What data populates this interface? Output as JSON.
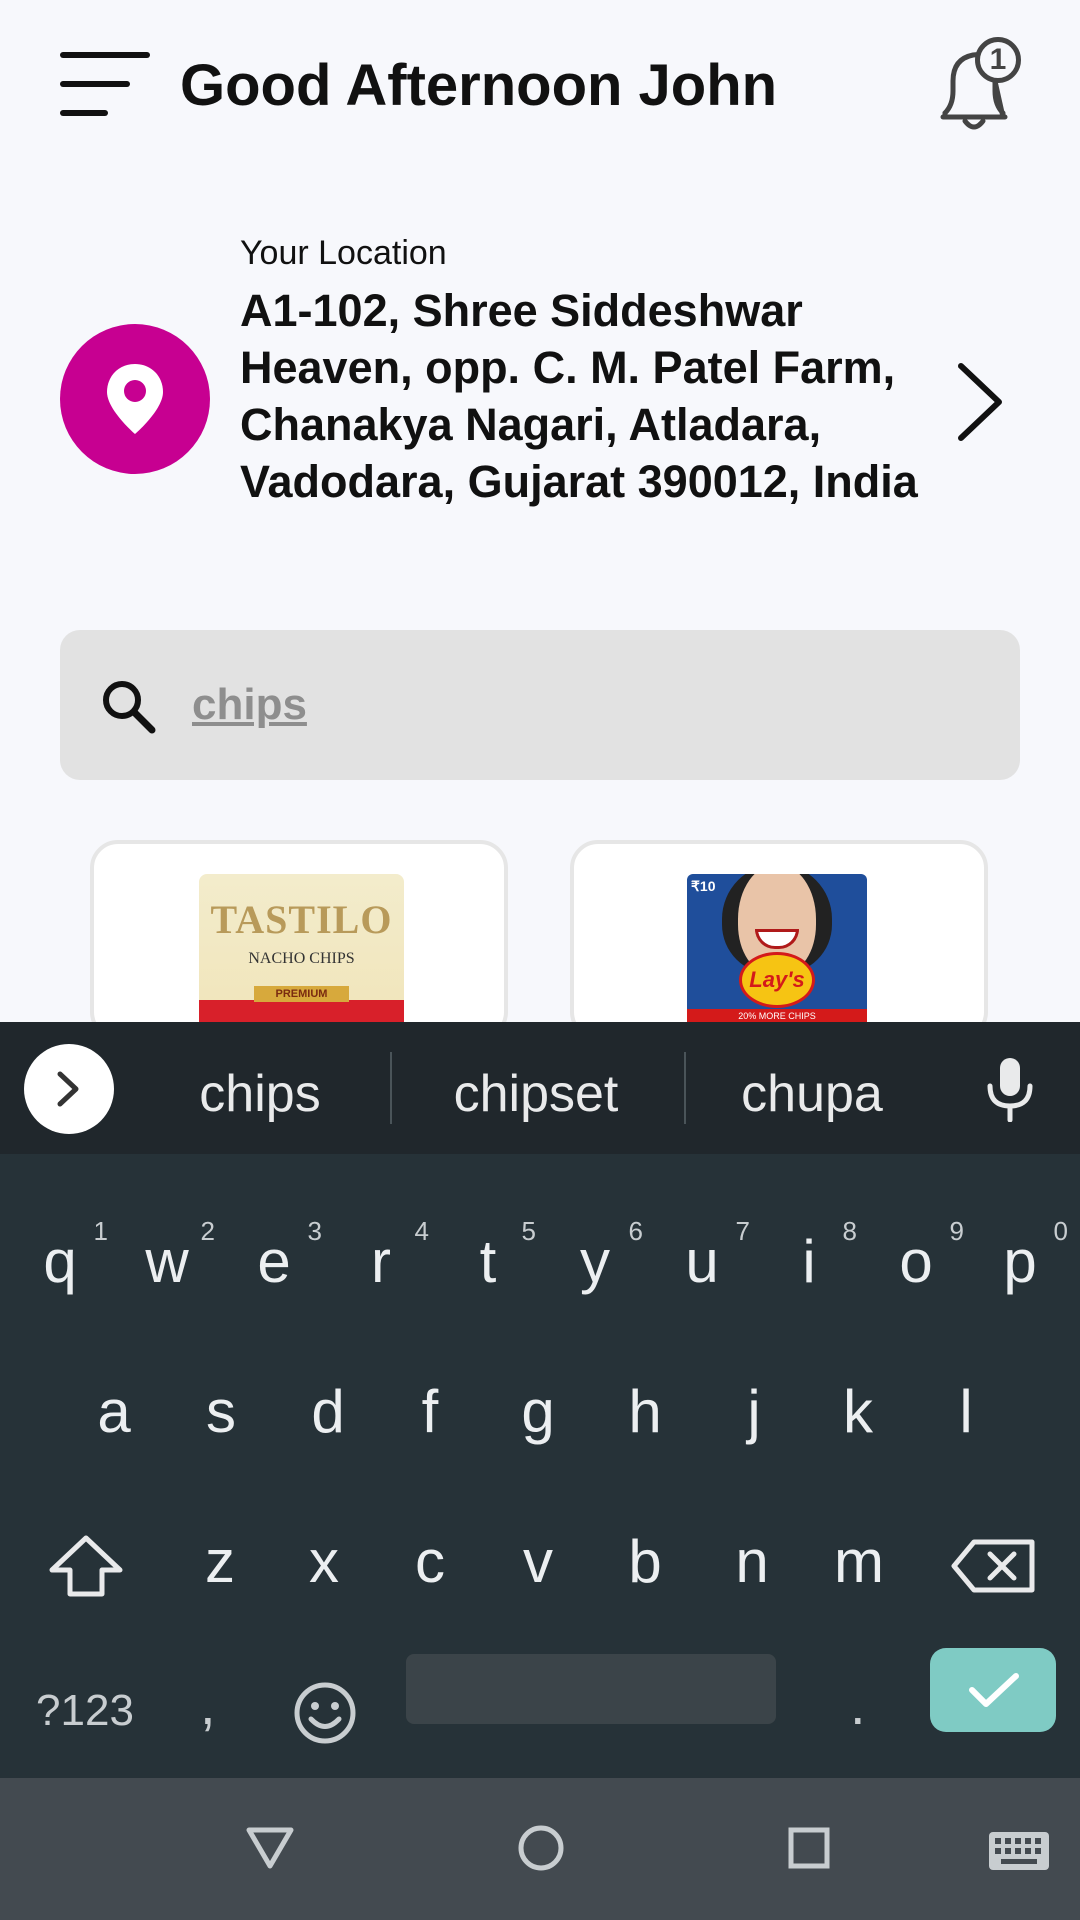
{
  "header": {
    "greeting": "Good Afternoon John",
    "notification_count": "1"
  },
  "location": {
    "label": "Your Location",
    "address": "A1-102, Shree Siddeshwar Heaven, opp. C. M. Patel Farm, Chanakya Nagari, Atladara, Vadodara, Gujarat 390012, India"
  },
  "search": {
    "value": "chips"
  },
  "products": [
    {
      "brand": "TASTILO",
      "subtitle": "NACHO CHIPS",
      "badge": "PREMIUM"
    },
    {
      "brand": "Lay's",
      "price": "₹10",
      "banner": "20% MORE CHIPS"
    }
  ],
  "keyboard": {
    "suggestions": [
      "chips",
      "chipset",
      "chupa"
    ],
    "row1": [
      "q",
      "w",
      "e",
      "r",
      "t",
      "y",
      "u",
      "i",
      "o",
      "p"
    ],
    "row1_hints": [
      "1",
      "2",
      "3",
      "4",
      "5",
      "6",
      "7",
      "8",
      "9",
      "0"
    ],
    "row2": [
      "a",
      "s",
      "d",
      "f",
      "g",
      "h",
      "j",
      "k",
      "l"
    ],
    "row3": [
      "z",
      "x",
      "c",
      "v",
      "b",
      "n",
      "m"
    ],
    "symbols_label": "?123",
    "comma": ",",
    "period": "."
  },
  "colors": {
    "accent": "#c70091",
    "enter_key": "#7fcbc4",
    "keyboard_bg": "#263238"
  }
}
